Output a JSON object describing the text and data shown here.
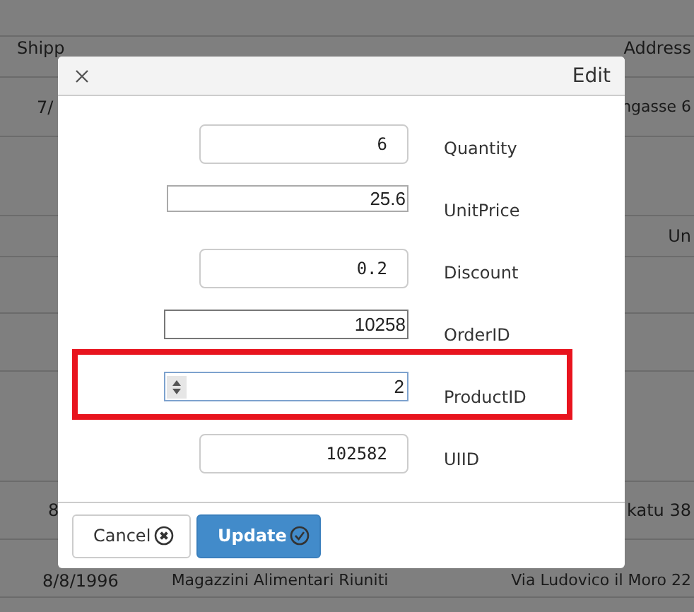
{
  "grid": {
    "header": [
      "Shipp",
      "Address"
    ],
    "subheader": [
      "Un"
    ],
    "rows": [
      {
        "cells": [
          "7/",
          "ngasse 6"
        ]
      },
      {
        "cells": [
          "8",
          "katu 38"
        ]
      },
      {
        "cells": [
          "8/8/1996",
          "Magazzini Alimentari Riuniti",
          "Via Ludovico il Moro 22"
        ]
      }
    ]
  },
  "dialog": {
    "title": "Edit",
    "fields": [
      {
        "label": "Quantity",
        "value": "6",
        "kind": "rounded",
        "highlighted": false
      },
      {
        "label": "UnitPrice",
        "value": "25.6",
        "kind": "plain",
        "highlighted": false
      },
      {
        "label": "Discount",
        "value": "0.2",
        "kind": "rounded",
        "highlighted": false
      },
      {
        "label": "OrderID",
        "value": "10258",
        "kind": "plain",
        "highlighted": false
      },
      {
        "label": "ProductID",
        "value": "2",
        "kind": "spinner",
        "highlighted": true
      },
      {
        "label": "UIID",
        "value": "102582",
        "kind": "rounded",
        "highlighted": false
      }
    ],
    "buttons": [
      {
        "label": "Cancel",
        "kind": "cancel"
      },
      {
        "label": "Update",
        "kind": "update"
      }
    ]
  }
}
